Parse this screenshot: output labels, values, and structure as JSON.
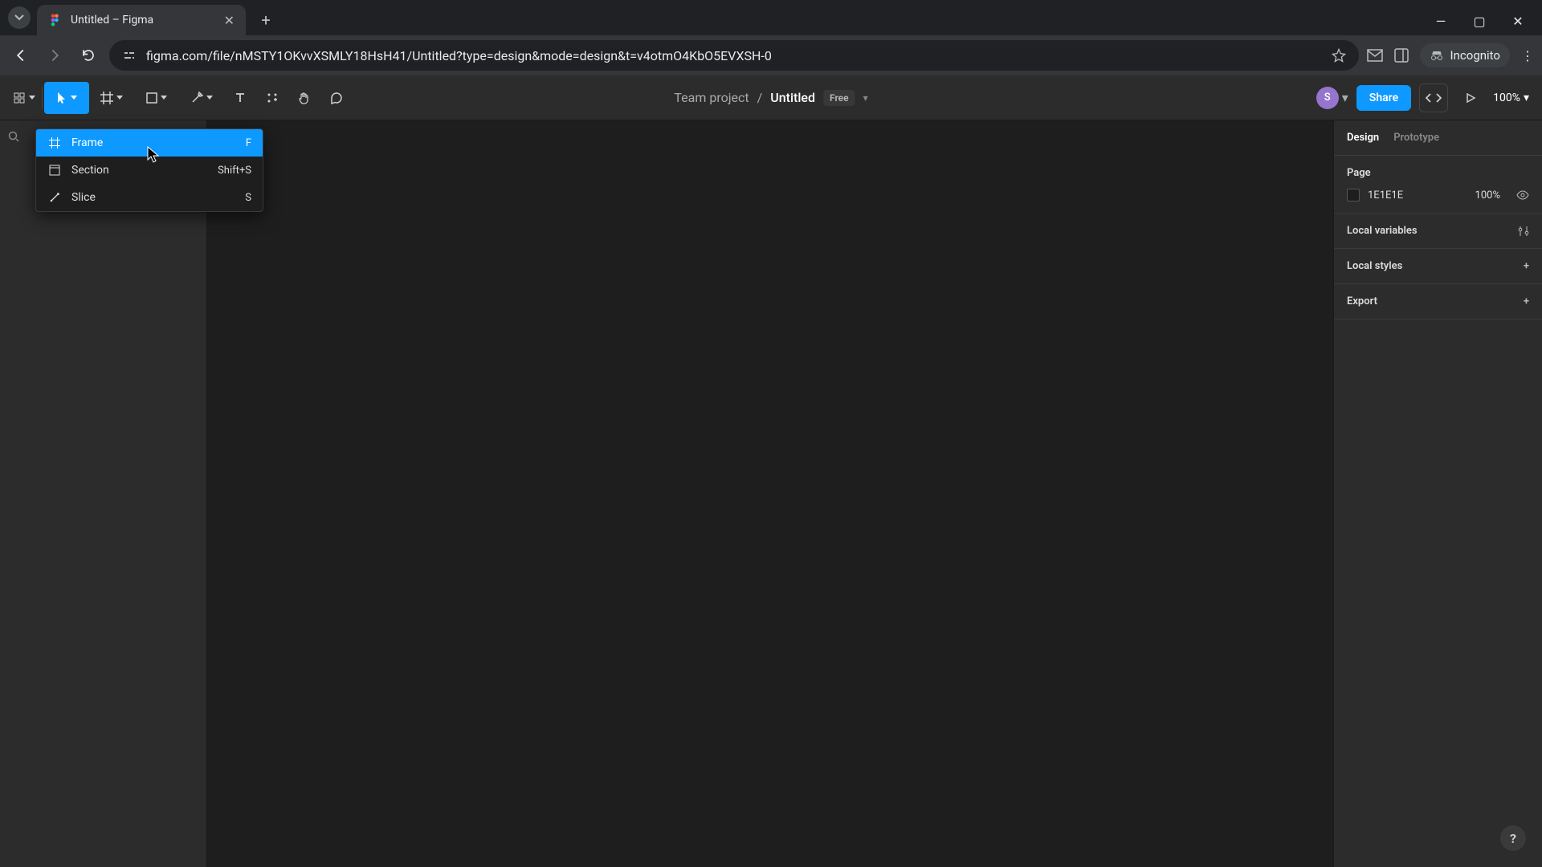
{
  "browser": {
    "tab_title": "Untitled – Figma",
    "url": "figma.com/file/nMSTY1OKvvXSMLY18HsH41/Untitled?type=design&mode=design&t=v4otmO4KbO5EVXSH-0",
    "incognito_label": "Incognito"
  },
  "toolbar": {
    "breadcrumb_project": "Team project",
    "breadcrumb_file": "Untitled",
    "plan_badge": "Free",
    "share_label": "Share",
    "zoom": "100%",
    "avatar_initial": "S"
  },
  "dropdown": {
    "items": [
      {
        "label": "Frame",
        "shortcut": "F",
        "hover": true
      },
      {
        "label": "Section",
        "shortcut": "Shift+S",
        "hover": false
      },
      {
        "label": "Slice",
        "shortcut": "S",
        "hover": false
      }
    ]
  },
  "right_panel": {
    "tabs": {
      "design": "Design",
      "prototype": "Prototype"
    },
    "page_label": "Page",
    "page_color": "1E1E1E",
    "page_opacity": "100%",
    "local_variables": "Local variables",
    "local_styles": "Local styles",
    "export": "Export"
  },
  "help_label": "?"
}
